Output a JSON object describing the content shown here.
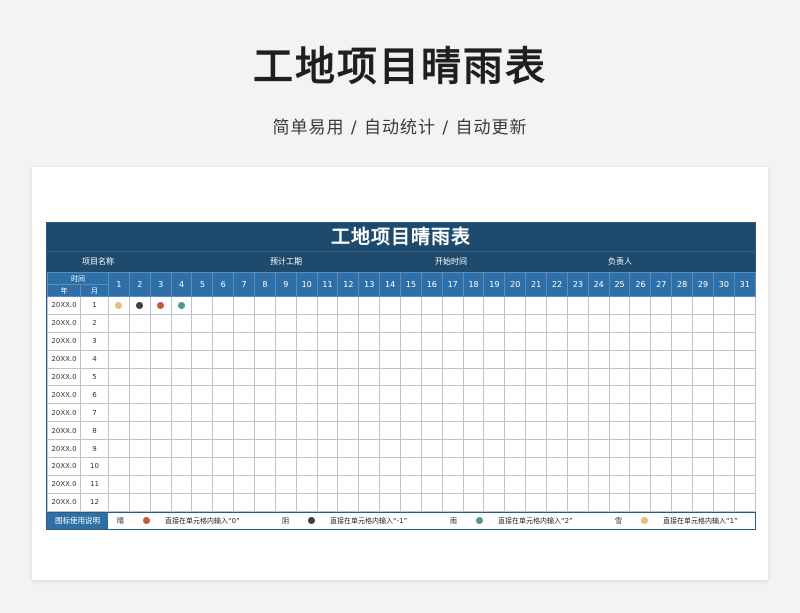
{
  "page": {
    "title": "工地项目晴雨表",
    "subtitle": "简单易用 / 自动统计 / 自动更新"
  },
  "sheet": {
    "title": "工地项目晴雨表",
    "info": {
      "project_name_label": "项目名称",
      "duration_label": "预计工期",
      "start_time_label": "开始时间",
      "owner_label": "负责人"
    },
    "header": {
      "time_label": "时间",
      "year_label": "年",
      "month_label": "月",
      "days": [
        "1",
        "2",
        "3",
        "4",
        "5",
        "6",
        "7",
        "8",
        "9",
        "10",
        "11",
        "12",
        "13",
        "14",
        "15",
        "16",
        "17",
        "18",
        "19",
        "20",
        "21",
        "22",
        "23",
        "24",
        "25",
        "26",
        "27",
        "28",
        "29",
        "30",
        "31"
      ]
    },
    "rows": [
      {
        "year": "20XX.0",
        "month": "1",
        "marks": [
          {
            "day": 1,
            "weather": "snow"
          },
          {
            "day": 2,
            "weather": "overcast"
          },
          {
            "day": 3,
            "weather": "sunny"
          },
          {
            "day": 4,
            "weather": "rain"
          }
        ]
      },
      {
        "year": "20XX.0",
        "month": "2",
        "marks": []
      },
      {
        "year": "20XX.0",
        "month": "3",
        "marks": []
      },
      {
        "year": "20XX.0",
        "month": "4",
        "marks": []
      },
      {
        "year": "20XX.0",
        "month": "5",
        "marks": []
      },
      {
        "year": "20XX.0",
        "month": "6",
        "marks": []
      },
      {
        "year": "20XX.0",
        "month": "7",
        "marks": []
      },
      {
        "year": "20XX.0",
        "month": "8",
        "marks": []
      },
      {
        "year": "20XX.0",
        "month": "9",
        "marks": []
      },
      {
        "year": "20XX.0",
        "month": "10",
        "marks": []
      },
      {
        "year": "20XX.0",
        "month": "11",
        "marks": []
      },
      {
        "year": "20XX.0",
        "month": "12",
        "marks": []
      }
    ],
    "legend": {
      "label": "图标使用说明",
      "items": [
        {
          "key": "sunny",
          "name": "晴",
          "text": "直接在单元格内输入“0”"
        },
        {
          "key": "overcast",
          "name": "阴",
          "text": "直接在单元格内输入“-1”"
        },
        {
          "key": "rain",
          "name": "雨",
          "text": "直接在单元格内输入“2”"
        },
        {
          "key": "snow",
          "name": "雪",
          "text": "直接在单元格内输入“1”"
        }
      ]
    }
  },
  "colors": {
    "sunny": "#c9573f",
    "overcast": "#3f3f3f",
    "rain": "#4f9a8c",
    "snow": "#e2c07a",
    "header_dark": "#1e4a6e",
    "header_blue": "#2f6fa8"
  }
}
